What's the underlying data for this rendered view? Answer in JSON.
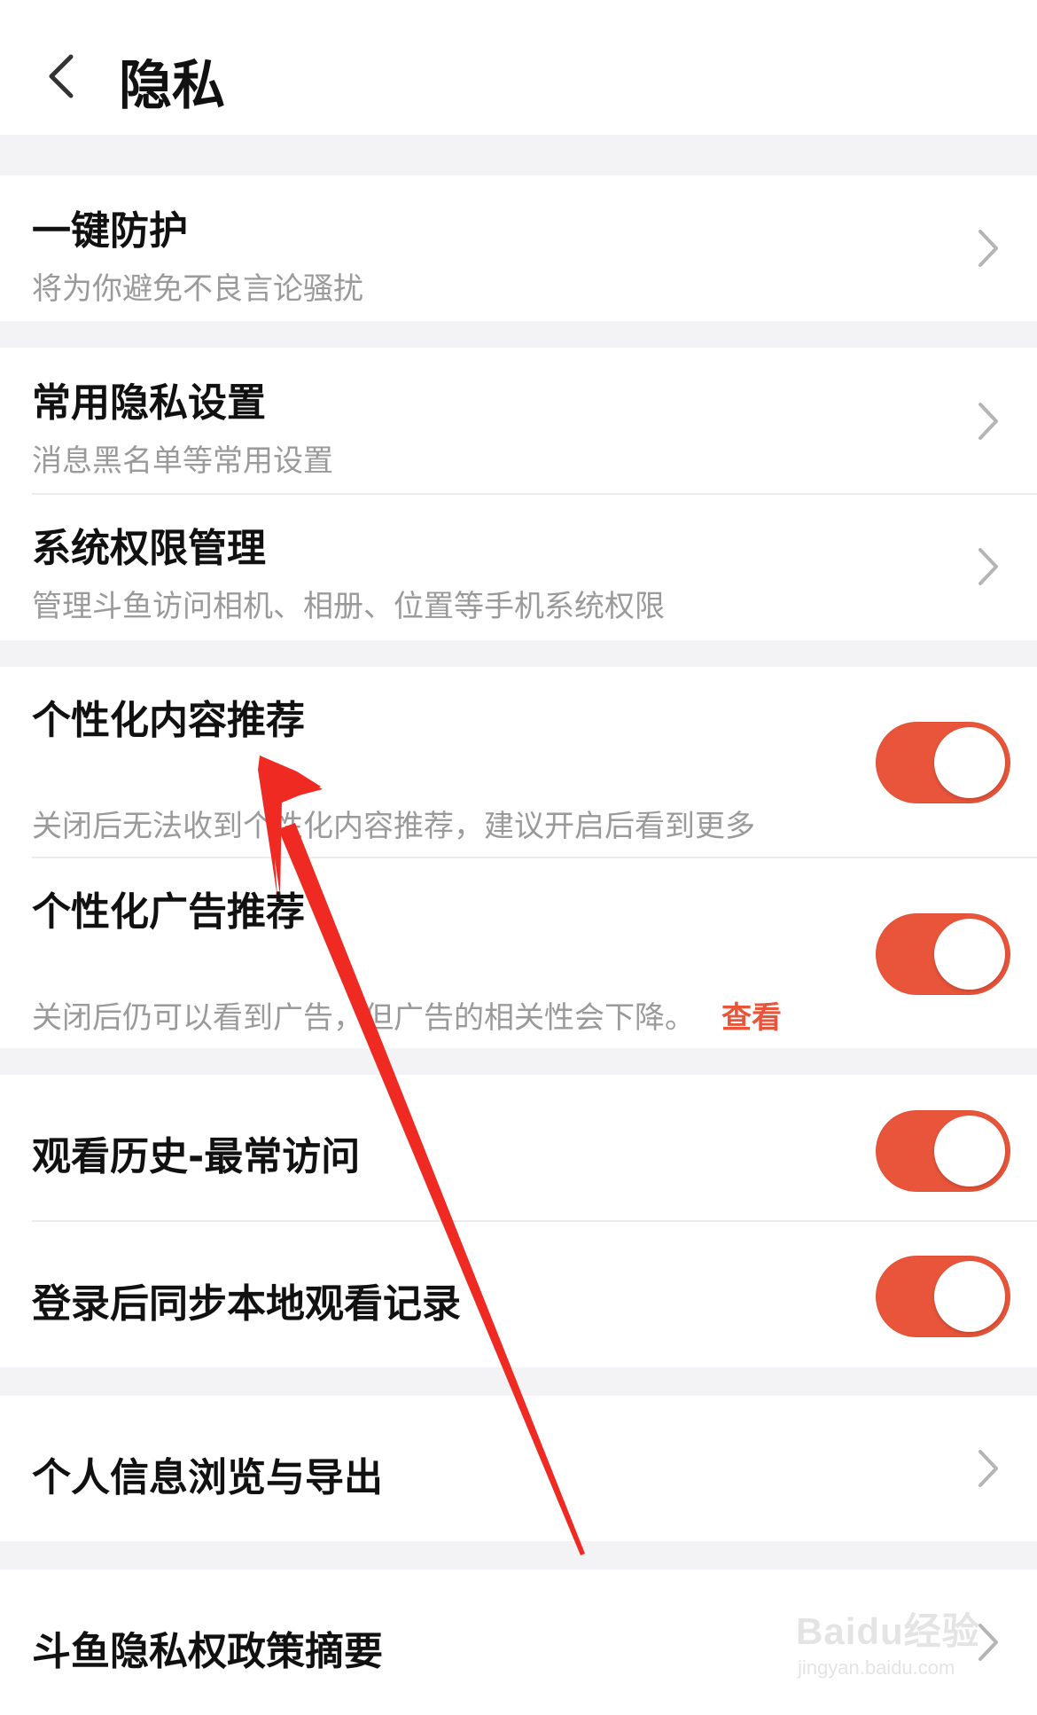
{
  "header": {
    "title": "隐私"
  },
  "sections": {
    "one_key": {
      "title": "一键防护",
      "subtitle": "将为你避免不良言论骚扰"
    },
    "common": {
      "title": "常用隐私设置",
      "subtitle": "消息黑名单等常用设置"
    },
    "system": {
      "title": "系统权限管理",
      "subtitle": "管理斗鱼访问相机、相册、位置等手机系统权限"
    },
    "personal_content": {
      "title": "个性化内容推荐",
      "subtitle": "关闭后无法收到个性化内容推荐，建议开启后看到更多",
      "enabled": true
    },
    "personal_ads": {
      "title": "个性化广告推荐",
      "subtitle": "关闭后仍可以看到广告，但广告的相关性会下降。",
      "link": "查看",
      "enabled": true
    },
    "history": {
      "title": "观看历史-最常访问",
      "enabled": true
    },
    "sync": {
      "title": "登录后同步本地观看记录",
      "enabled": true
    },
    "info_export": {
      "title": "个人信息浏览与导出"
    },
    "policy": {
      "title": "斗鱼隐私权政策摘要"
    }
  },
  "colors": {
    "accent": "#e9553a",
    "annotation_arrow": "#ee2a22"
  },
  "watermark": {
    "brand": "Baidu经验",
    "url": "jingyan.baidu.com"
  }
}
